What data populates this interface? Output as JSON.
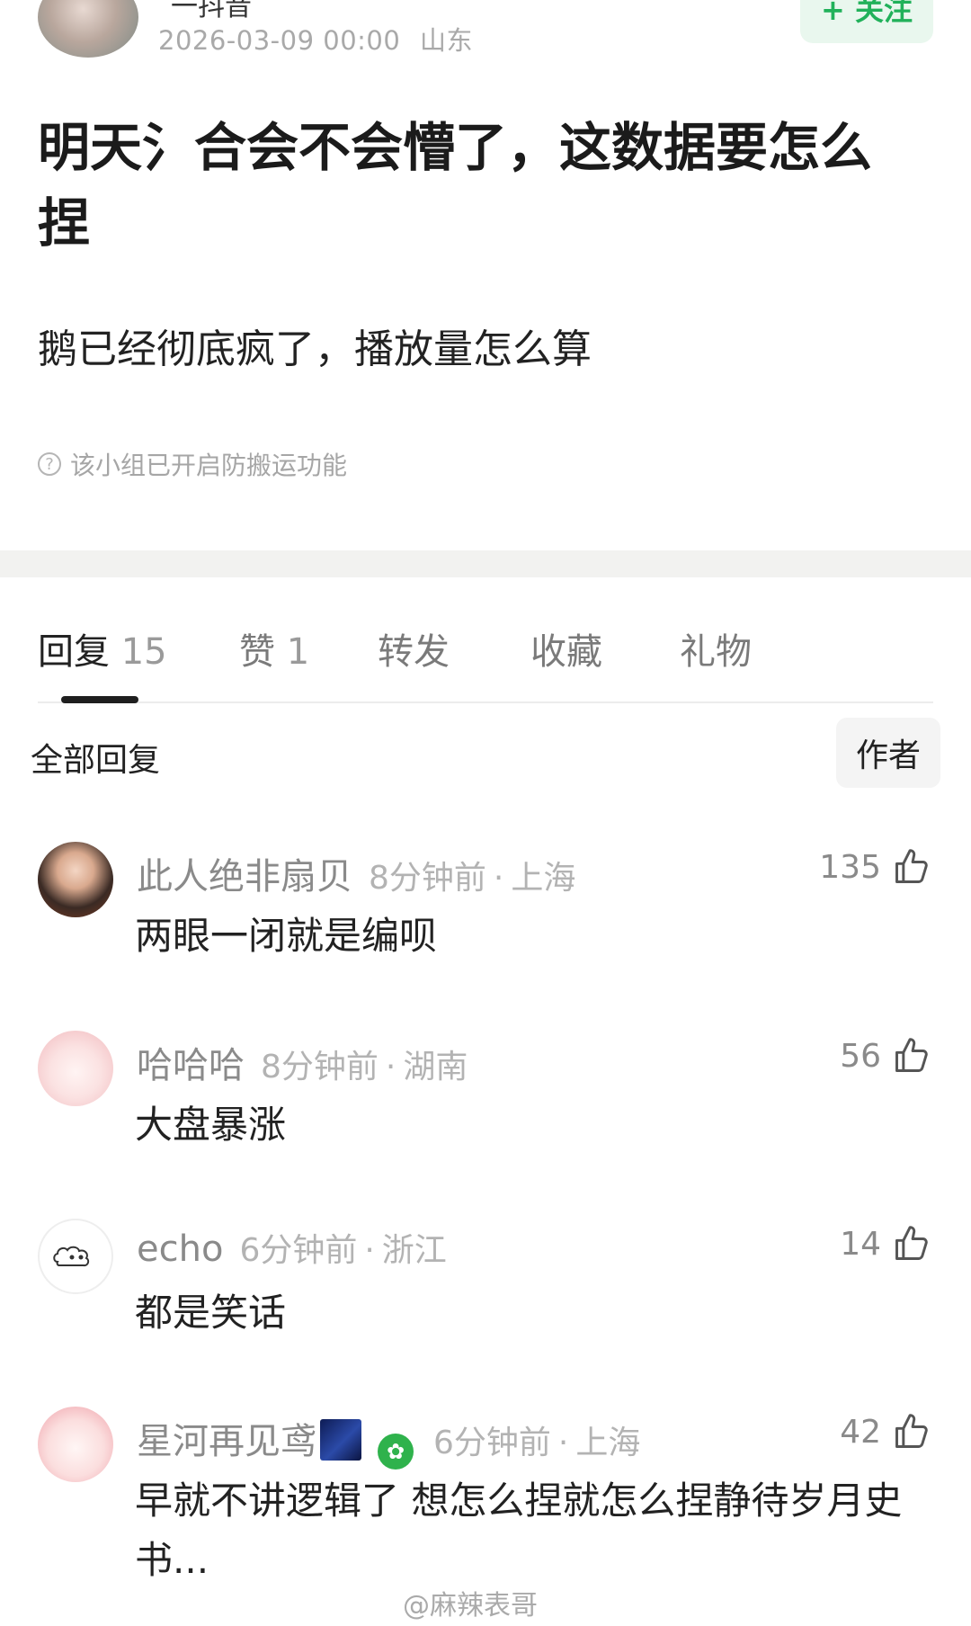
{
  "post": {
    "author_name": "一抖音",
    "timestamp": "2026-03-09 00:00",
    "location": "山东",
    "follow_label": "+ 关注",
    "title": "明天氵合会不会懵了，这数据要怎么捏",
    "body": "鹅已经彻底疯了，播放量怎么算",
    "notice": "该小组已开启防搬运功能"
  },
  "tabs": [
    {
      "label": "回复",
      "count": "15"
    },
    {
      "label": "赞",
      "count": "1"
    },
    {
      "label": "转发",
      "count": ""
    },
    {
      "label": "收藏",
      "count": ""
    },
    {
      "label": "礼物",
      "count": ""
    }
  ],
  "filter": {
    "all_label": "全部回复",
    "author_label": "作者"
  },
  "comments": [
    {
      "name": "此人绝非扇贝",
      "time": "8分钟前",
      "location": "上海",
      "likes": "135",
      "text": "两眼一闭就是编呗"
    },
    {
      "name": "哈哈哈",
      "time": "8分钟前",
      "location": "湖南",
      "likes": "56",
      "text": "大盘暴涨"
    },
    {
      "name": "echo",
      "time": "6分钟前",
      "location": "浙江",
      "likes": "14",
      "text": "都是笑话"
    },
    {
      "name": "星河再见鸢",
      "time": "6分钟前",
      "location": "上海",
      "likes": "42",
      "text": "早就不讲逻辑了 想怎么捏就怎么捏静待岁月史书..."
    }
  ],
  "watermark": "@麻辣表哥",
  "colors": {
    "accent_green": "#21b15a",
    "text_gray": "#8a8a8a"
  }
}
